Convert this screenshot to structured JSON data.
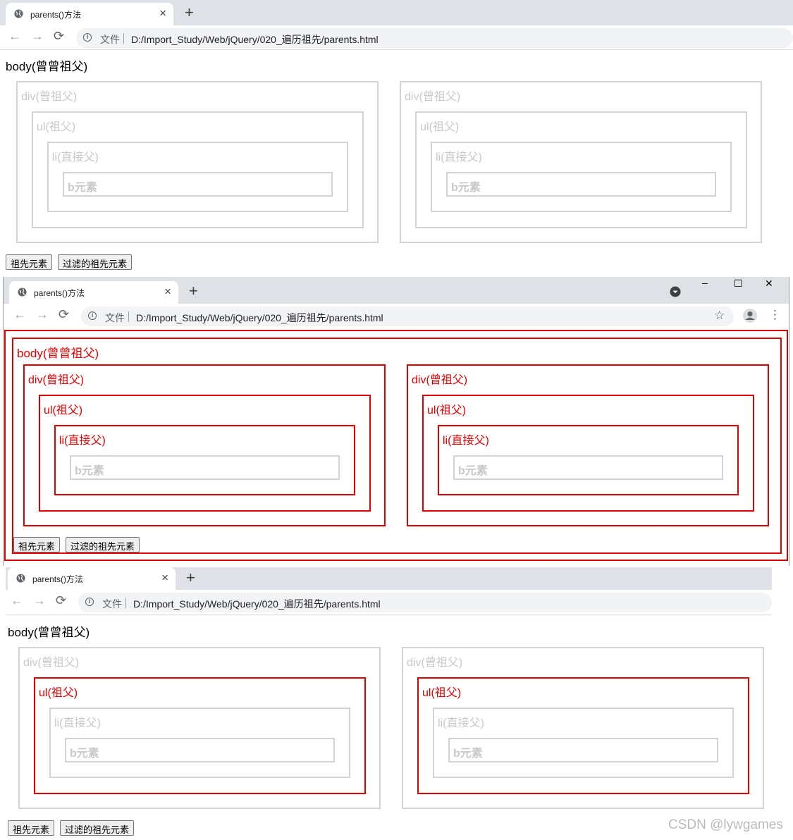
{
  "browser": {
    "tab_title": "parents()方法",
    "tab_close": "×",
    "new_tab": "+",
    "back": "←",
    "forward": "→",
    "reload": "⟳",
    "file_label": "文件",
    "url": "D:/Import_Study/Web/jQuery/020_遍历祖先/parents.html",
    "bookmark_star": "☆",
    "menu_dots": "⋮",
    "window_min": "–",
    "window_max": "☐",
    "window_close": "✕"
  },
  "demo": {
    "body_label": "body(曾曾祖父)",
    "div_label": "div(曾祖父)",
    "ul_label": "ul(祖父)",
    "li_label": "li(直接父)",
    "b_label": "b元素",
    "btn_ancestors": "祖先元素",
    "btn_filtered": "过滤的祖先元素"
  },
  "colors": {
    "highlight": "#e00000",
    "default_border": "#d3d3d3"
  },
  "watermark": "CSDN @lywgames"
}
